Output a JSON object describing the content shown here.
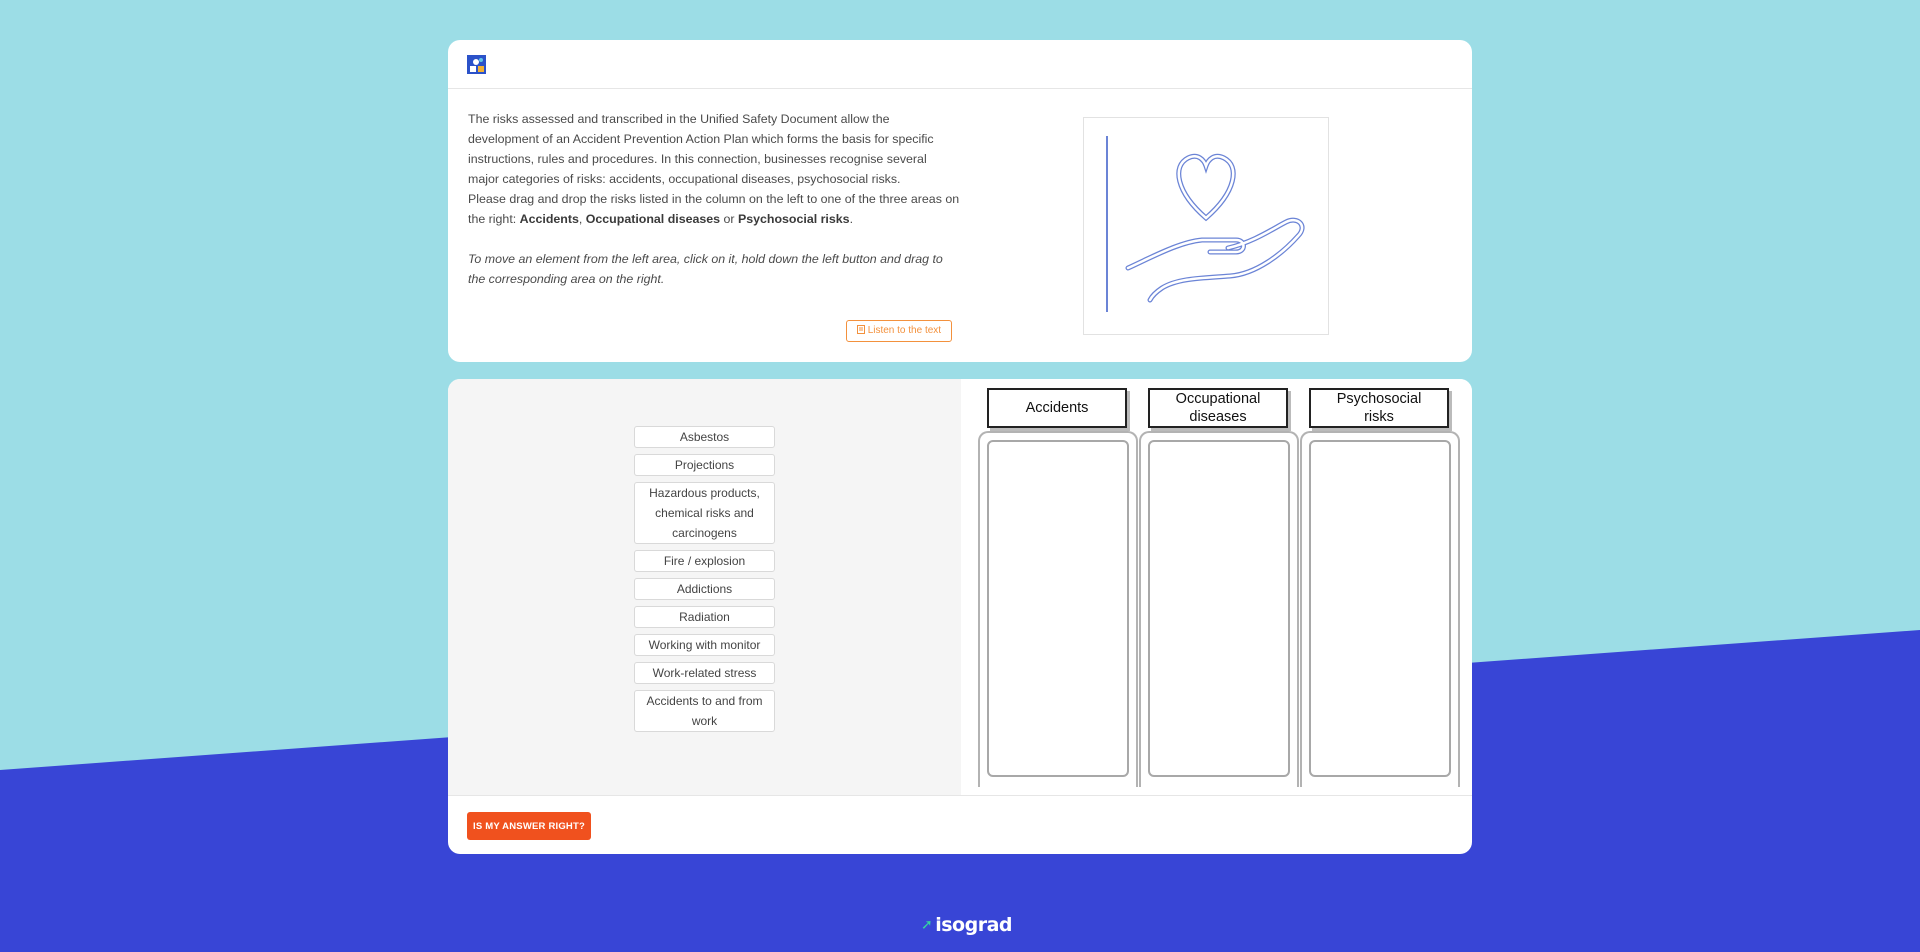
{
  "colors": {
    "background_light": "#9cdde6",
    "background_dark": "#3845d6",
    "accent_orange": "#f0511e",
    "listen_orange": "#f3913d",
    "brand_green": "#35d3a0"
  },
  "header": {
    "logo_icon": "app-logo-icon"
  },
  "intro": {
    "paragraph1": "The risks assessed and transcribed in the Unified Safety Document allow the development of an Accident Prevention Action Plan which forms the basis for specific instructions, rules and procedures. In this connection, businesses recognise several major categories of risks: accidents, occupational diseases, psychosocial risks.",
    "paragraph2_start": "Please drag and drop the risks listed in the column on the left to one of the three areas on the right: ",
    "bold1": "Accidents",
    "sep1": ", ",
    "bold2": "Occupational diseases",
    "sep2": " or ",
    "bold3": "Psychosocial risks",
    "end": ".",
    "hint": "To move an element from the left area, click on it, hold down the left button and drag to the corresponding area on the right.",
    "listen_icon": "document-icon",
    "listen_label": "Listen to the text"
  },
  "illustration": {
    "icon": "heart-in-hand-icon"
  },
  "draggable_items": [
    "Asbestos",
    "Projections",
    "Hazardous products, chemical risks and carcinogens",
    "Fire / explosion",
    "Addictions",
    "Radiation",
    "Working with monitor",
    "Work-related stress",
    "Accidents to and from work"
  ],
  "drop_zones": [
    {
      "label": "Accidents"
    },
    {
      "label": "Occupational diseases"
    },
    {
      "label": "Psychosocial risks"
    }
  ],
  "footer": {
    "answer_button": "IS MY ANSWER RIGHT?"
  },
  "brand": {
    "icon": "isograd-arrow-icon",
    "name": "isograd"
  }
}
